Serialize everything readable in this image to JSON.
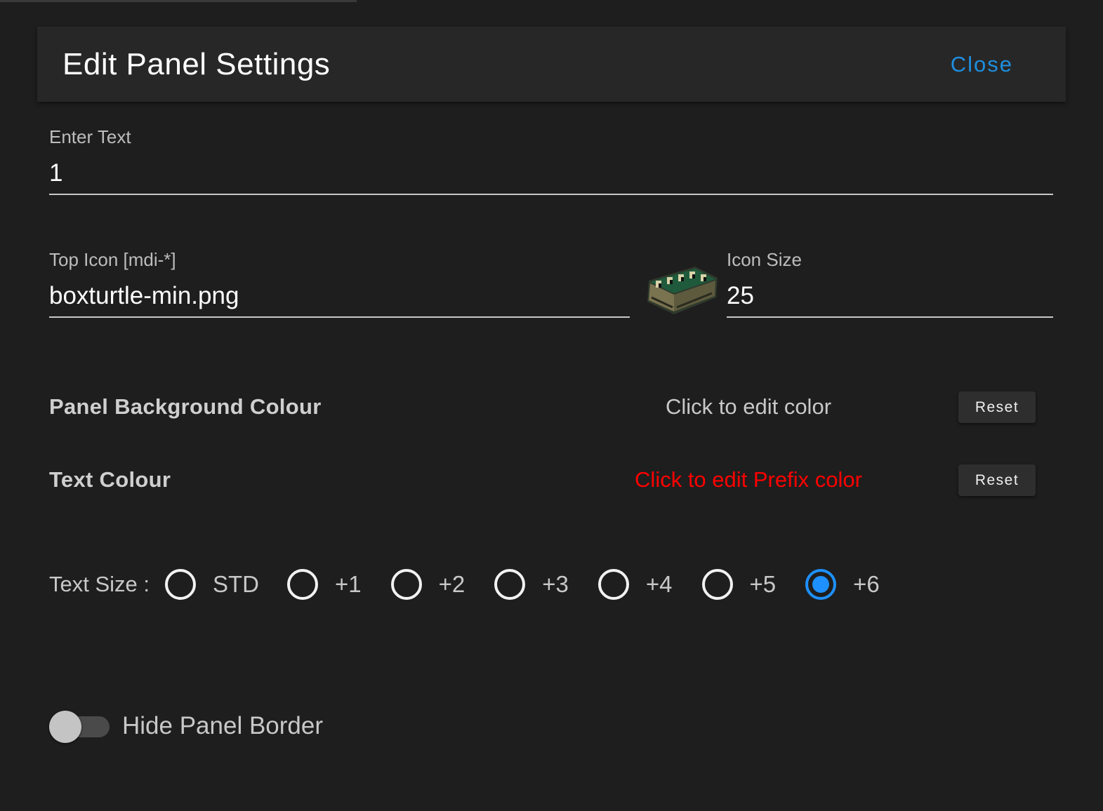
{
  "dialog": {
    "title": "Edit Panel Settings",
    "close_label": "Close"
  },
  "fields": {
    "enter_text": {
      "label": "Enter Text",
      "value": "1"
    },
    "top_icon": {
      "label": "Top Icon [mdi-*]",
      "value": "boxturtle-min.png"
    },
    "icon_size": {
      "label": "Icon Size",
      "value": "25"
    }
  },
  "icon_preview": {
    "icon": "boxturtle-image"
  },
  "colors": {
    "background": {
      "label": "Panel Background Colour",
      "action": "Click to edit color",
      "reset": "Reset"
    },
    "text": {
      "label": "Text Colour",
      "action": "Click to edit Prefix color",
      "action_color": "#ff0000",
      "reset": "Reset"
    }
  },
  "text_size": {
    "label": "Text Size :",
    "selected": "+6",
    "options": [
      "STD",
      "+1",
      "+2",
      "+3",
      "+4",
      "+5",
      "+6"
    ]
  },
  "hide_border": {
    "label": "Hide Panel Border",
    "on": false
  },
  "accent_color": "#1e90ff"
}
